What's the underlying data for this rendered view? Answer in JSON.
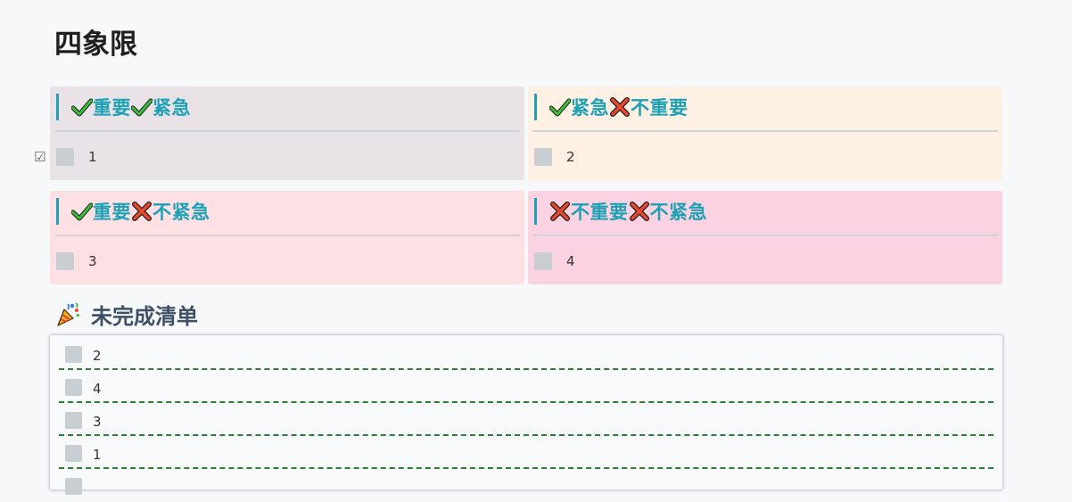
{
  "page_title": "四象限",
  "quadrants": [
    {
      "id": "q1",
      "segments": [
        {
          "icon": "check-icon",
          "label": "重要"
        },
        {
          "icon": "check-icon",
          "label": "紧急"
        }
      ],
      "task": "1",
      "bg": "#e9e3e7"
    },
    {
      "id": "q2",
      "segments": [
        {
          "icon": "check-icon",
          "label": "紧急"
        },
        {
          "icon": "cross-icon",
          "label": "不重要"
        }
      ],
      "task": "2",
      "bg": "#fff0e4"
    },
    {
      "id": "q3",
      "segments": [
        {
          "icon": "check-icon",
          "label": "重要"
        },
        {
          "icon": "cross-icon",
          "label": "不紧急"
        }
      ],
      "task": "3",
      "bg": "#fde0e3"
    },
    {
      "id": "q4",
      "segments": [
        {
          "icon": "cross-icon",
          "label": "不重要"
        },
        {
          "icon": "cross-icon",
          "label": "不紧急"
        }
      ],
      "task": "4",
      "bg": "#fbd2e1"
    }
  ],
  "incomplete": {
    "title": "未完成清单",
    "icon": "party-popper-icon",
    "items": [
      "2",
      "4",
      "3",
      "1"
    ]
  },
  "colors": {
    "heading_accent": "#1ea0b5",
    "divider_dash": "#2e7d32",
    "checkbox": "#c9ced3"
  }
}
